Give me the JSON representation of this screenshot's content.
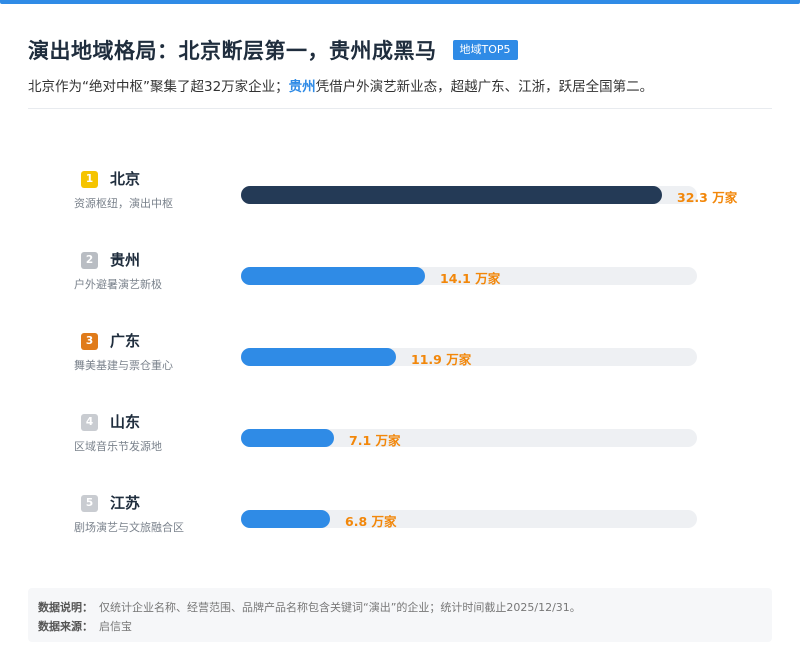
{
  "header": {
    "title": "演出地域格局：北京断层第一，贵州成黑马",
    "badge": "地域TOP5",
    "subtitle_pre": "北京作为“绝对中枢”聚集了超32万家企业；",
    "subtitle_hl": "贵州",
    "subtitle_post": "凭借户外演艺新业态，超越广东、江浙，跃居全国第二。"
  },
  "chart_data": {
    "type": "bar",
    "orientation": "horizontal",
    "categories": [
      "北京",
      "贵州",
      "广东",
      "山东",
      "江苏"
    ],
    "ranks": [
      "1",
      "2",
      "3",
      "4",
      "5"
    ],
    "descriptions": [
      "资源枢纽，演出中枢",
      "户外避暑演艺新极",
      "舞美基建与票仓重心",
      "区域音乐节发源地",
      "剧场演艺与文旅融合区"
    ],
    "values": [
      32.3,
      14.1,
      11.9,
      7.1,
      6.8
    ],
    "value_labels": [
      "32.3 万家",
      "14.1 万家",
      "11.9 万家",
      "7.1 万家",
      "6.8 万家"
    ],
    "unit": "万家",
    "xlim": [
      0,
      32.3
    ],
    "rank_colors": [
      "#f5c400",
      "#b9bdc3",
      "#e07b1a",
      "#c9ccd1",
      "#c9ccd1"
    ],
    "bar_colors": [
      "#243a56",
      "#2f8be6",
      "#2f8be6",
      "#2f8be6",
      "#2f8be6"
    ],
    "value_color": "#f2870a",
    "grid": false
  },
  "footer": {
    "note_label": "数据说明：",
    "note_text": "仅统计企业名称、经营范围、品牌产品名称包含关键词“演出”的企业；统计时间截止2025/12/31。",
    "source_label": "数据来源：",
    "source_text": "启信宝"
  }
}
